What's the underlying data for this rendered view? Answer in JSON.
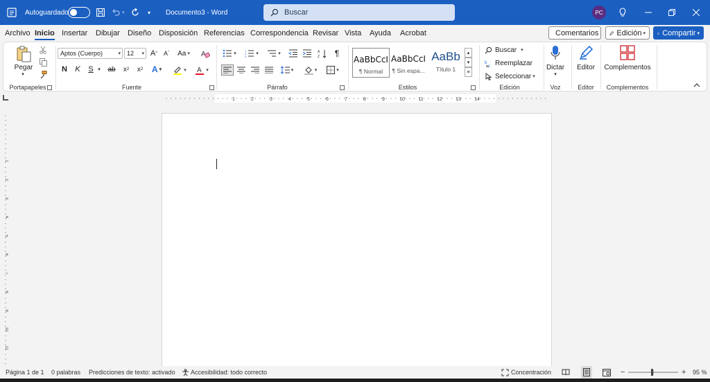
{
  "titlebar": {
    "autosave_label": "Autoguardado",
    "doc_title": "Documento3  -  Word",
    "search_placeholder": "Buscar",
    "avatar_initials": "PC"
  },
  "tabs": [
    "Archivo",
    "Inicio",
    "Insertar",
    "Dibujar",
    "Diseño",
    "Disposición",
    "Referencias",
    "Correspondencia",
    "Revisar",
    "Vista",
    "Ayuda",
    "Acrobat"
  ],
  "active_tab": "Inicio",
  "top_buttons": {
    "comments": "Comentarios",
    "editing": "Edición",
    "share": "Compartir"
  },
  "ribbon": {
    "clipboard": {
      "paste": "Pegar",
      "group": "Portapapeles"
    },
    "font": {
      "name": "Aptos (Cuerpo)",
      "size": "12",
      "group": "Fuente",
      "bold": "N",
      "italic": "K",
      "underline": "S",
      "strike": "ab",
      "subscript": "x",
      "subscript_sub": "2",
      "superscript": "x",
      "superscript_sup": "2",
      "case": "Aa",
      "text_effects": "A",
      "font_color": "A"
    },
    "paragraph": {
      "group": "Párrafo"
    },
    "styles": {
      "group": "Estilos",
      "items": [
        {
          "preview": "AaBbCcI",
          "name": "¶ Normal"
        },
        {
          "preview": "AaBbCcI",
          "name": "¶ Sin espa..."
        },
        {
          "preview": "AaBb",
          "name": "Título 1"
        }
      ]
    },
    "editing": {
      "group": "Edición",
      "find": "Buscar",
      "replace": "Reemplazar",
      "select": "Seleccionar"
    },
    "voice": {
      "dictate": "Dictar",
      "group": "Voz"
    },
    "editor": {
      "label": "Editor",
      "group": "Editor"
    },
    "addins": {
      "label": "Complementos",
      "group": "Complementos"
    }
  },
  "ruler": {
    "h_numbers": [
      "1",
      "2",
      "3",
      "4",
      "5",
      "6",
      "7",
      "8",
      "9",
      "10",
      "11",
      "12",
      "13",
      "14"
    ],
    "v_numbers": [
      "1",
      "2",
      "3",
      "4",
      "5",
      "6",
      "7",
      "8",
      "9",
      "10",
      "11"
    ]
  },
  "statusbar": {
    "page": "Página 1 de 1",
    "words": "0 palabras",
    "predictions": "Predicciones de texto: activado",
    "accessibility": "Accesibilidad: todo correcto",
    "focus": "Concentración",
    "zoom": "95 %",
    "zoom_fraction": 0.47
  },
  "colors": {
    "titlebar": "#1b5fc1",
    "accent": "#185abd",
    "highlight": "#ffff00",
    "font_color": "#e81123"
  }
}
